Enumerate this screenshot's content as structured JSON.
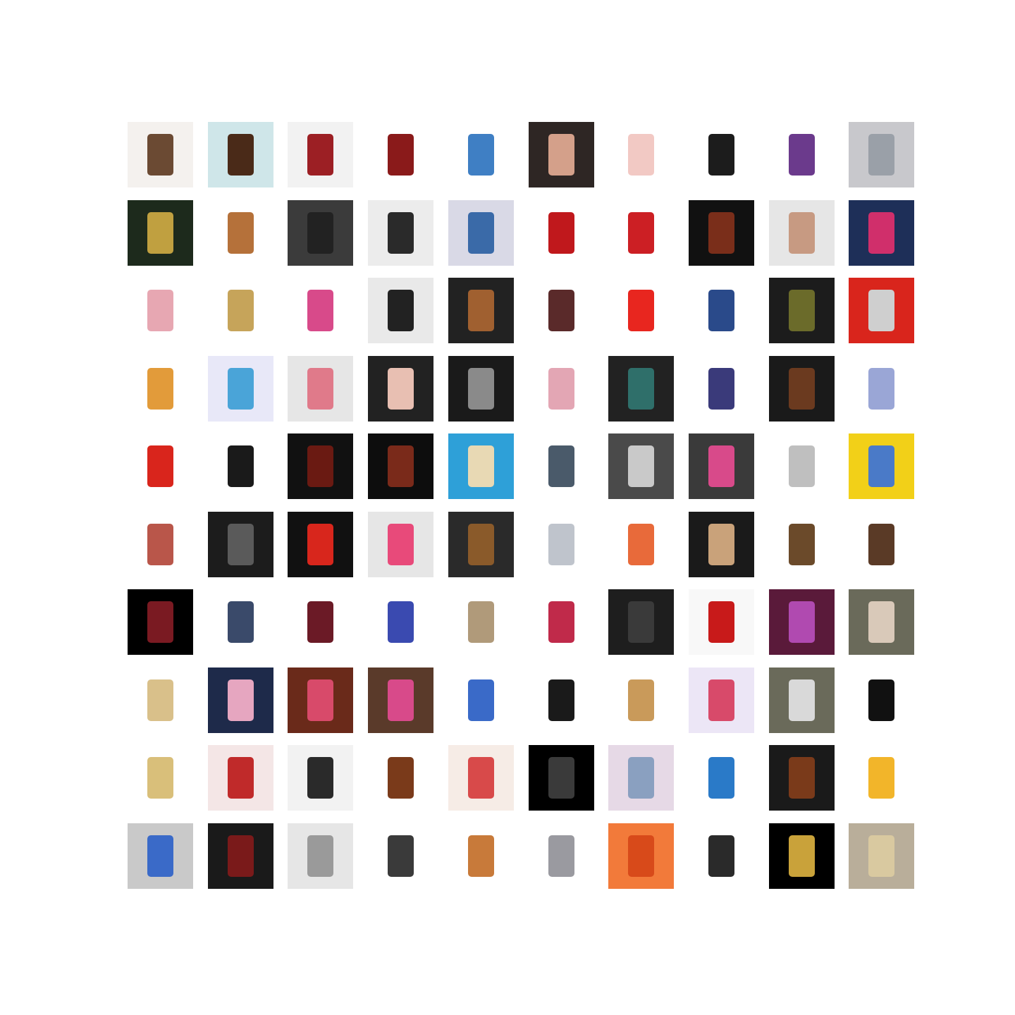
{
  "grid": {
    "rows": 10,
    "cols": 10,
    "tiles": [
      {
        "bg": "#f4f1ee",
        "accent": "#6b4a33",
        "caption": ""
      },
      {
        "bg": "#cfe6e9",
        "accent": "#4a2a18",
        "caption": ""
      },
      {
        "bg": "#f2f2f2",
        "accent": "#9c1f24",
        "caption": ""
      },
      {
        "bg": "#ffffff",
        "accent": "#8a1a1a",
        "caption": ""
      },
      {
        "bg": "#ffffff",
        "accent": "#3f7fc4",
        "caption": ""
      },
      {
        "bg": "#2e2624",
        "accent": "#d4a08a",
        "caption": ""
      },
      {
        "bg": "#ffffff",
        "accent": "#f2c9c4",
        "caption": ""
      },
      {
        "bg": "#ffffff",
        "accent": "#1c1c1c",
        "caption": ""
      },
      {
        "bg": "#ffffff",
        "accent": "#6b3a8c",
        "caption": ""
      },
      {
        "bg": "#c8c8cc",
        "accent": "#9aa0a8",
        "caption": ""
      },
      {
        "bg": "#1d2a1c",
        "accent": "#c0a040",
        "caption": ""
      },
      {
        "bg": "#ffffff",
        "accent": "#b5713a",
        "caption": ""
      },
      {
        "bg": "#3b3b3b",
        "accent": "#222222",
        "caption": ""
      },
      {
        "bg": "#ececec",
        "accent": "#2a2a2a",
        "caption": ""
      },
      {
        "bg": "#d9d9e6",
        "accent": "#3a6aa8",
        "caption": ""
      },
      {
        "bg": "#ffffff",
        "accent": "#c0181c",
        "caption": ""
      },
      {
        "bg": "#ffffff",
        "accent": "#cc1f24",
        "caption": ""
      },
      {
        "bg": "#111111",
        "accent": "#7a2e1a",
        "caption": ""
      },
      {
        "bg": "#e6e6e6",
        "accent": "#c79a82",
        "caption": ""
      },
      {
        "bg": "#1e2f58",
        "accent": "#d02f6b",
        "caption": ""
      },
      {
        "bg": "#ffffff",
        "accent": "#e7a7b2",
        "caption": ""
      },
      {
        "bg": "#ffffff",
        "accent": "#c6a45a",
        "caption": ""
      },
      {
        "bg": "#ffffff",
        "accent": "#d84a8a",
        "caption": ""
      },
      {
        "bg": "#e9e9e9",
        "accent": "#222222",
        "caption": ""
      },
      {
        "bg": "#222222",
        "accent": "#a06030",
        "caption": ""
      },
      {
        "bg": "#ffffff",
        "accent": "#5a2a2a",
        "caption": ""
      },
      {
        "bg": "#ffffff",
        "accent": "#e8261f",
        "caption": ""
      },
      {
        "bg": "#ffffff",
        "accent": "#2a4a8a",
        "caption": ""
      },
      {
        "bg": "#1c1c1c",
        "accent": "#6b6b2a",
        "caption": ""
      },
      {
        "bg": "#d9251c",
        "accent": "#cfcfcf",
        "caption": ""
      },
      {
        "bg": "#ffffff",
        "accent": "#e29b3a",
        "caption": ""
      },
      {
        "bg": "#e8e8f8",
        "accent": "#4aa4d8",
        "caption": ""
      },
      {
        "bg": "#e6e6e6",
        "accent": "#e07a8a",
        "caption": ""
      },
      {
        "bg": "#222222",
        "accent": "#e8bfb2",
        "caption": ""
      },
      {
        "bg": "#1a1a1a",
        "accent": "#8a8a8a",
        "caption": ""
      },
      {
        "bg": "#ffffff",
        "accent": "#e3a6b4",
        "caption": ""
      },
      {
        "bg": "#222222",
        "accent": "#2f6f6a",
        "caption": ""
      },
      {
        "bg": "#ffffff",
        "accent": "#3a3a7a",
        "caption": ""
      },
      {
        "bg": "#1a1a1a",
        "accent": "#6b3a1f",
        "caption": ""
      },
      {
        "bg": "#ffffff",
        "accent": "#9aa6d6",
        "caption": ""
      },
      {
        "bg": "#ffffff",
        "accent": "#d9251c",
        "caption": ""
      },
      {
        "bg": "#ffffff",
        "accent": "#1a1a1a",
        "caption": ""
      },
      {
        "bg": "#111111",
        "accent": "#6a1a12",
        "caption": ""
      },
      {
        "bg": "#0d0d0d",
        "accent": "#7a2a1a",
        "caption": ""
      },
      {
        "bg": "#2ea0d8",
        "accent": "#e8d9b4",
        "caption": ""
      },
      {
        "bg": "#ffffff",
        "accent": "#4a5a6a",
        "caption": ""
      },
      {
        "bg": "#4a4a4a",
        "accent": "#c9c9c9",
        "caption": ""
      },
      {
        "bg": "#3a3a3a",
        "accent": "#d84a8a",
        "caption": ""
      },
      {
        "bg": "#ffffff",
        "accent": "#bfbfbf",
        "caption": ""
      },
      {
        "bg": "#f2d018",
        "accent": "#4a7ac8",
        "caption": ""
      },
      {
        "bg": "#ffffff",
        "accent": "#b9564a",
        "caption": ""
      },
      {
        "bg": "#1c1c1c",
        "accent": "#5a5a5a",
        "caption": ""
      },
      {
        "bg": "#111111",
        "accent": "#d8261c",
        "caption": ""
      },
      {
        "bg": "#e6e6e6",
        "accent": "#e84a7a",
        "caption": ""
      },
      {
        "bg": "#2a2a2a",
        "accent": "#8a5a2a",
        "caption": ""
      },
      {
        "bg": "#ffffff",
        "accent": "#bfc4cc",
        "caption": ""
      },
      {
        "bg": "#ffffff",
        "accent": "#e86a3a",
        "caption": ""
      },
      {
        "bg": "#1a1a1a",
        "accent": "#c9a27a",
        "caption": ""
      },
      {
        "bg": "#ffffff",
        "accent": "#6b4a2a",
        "caption": ""
      },
      {
        "bg": "#ffffff",
        "accent": "#5a3a26",
        "caption": ""
      },
      {
        "bg": "#000000",
        "accent": "#7a1a22",
        "caption": ""
      },
      {
        "bg": "#ffffff",
        "accent": "#3a4a6a",
        "caption": ""
      },
      {
        "bg": "#ffffff",
        "accent": "#6b1a26",
        "caption": ""
      },
      {
        "bg": "#ffffff",
        "accent": "#3a4ab0",
        "caption": ""
      },
      {
        "bg": "#ffffff",
        "accent": "#b09a7a",
        "caption": ""
      },
      {
        "bg": "#ffffff",
        "accent": "#c02a4a",
        "caption": ""
      },
      {
        "bg": "#1e1e1e",
        "accent": "#3a3a3a",
        "caption": ""
      },
      {
        "bg": "#f8f8f8",
        "accent": "#c81a1a",
        "caption": ""
      },
      {
        "bg": "#5a1a3a",
        "accent": "#b04ab0",
        "caption": ""
      },
      {
        "bg": "#6a6a5a",
        "accent": "#d9c9b9",
        "caption": ""
      },
      {
        "bg": "#ffffff",
        "accent": "#d9c08a",
        "caption": ""
      },
      {
        "bg": "#1e2a4a",
        "accent": "#e6a6c0",
        "caption": ""
      },
      {
        "bg": "#6a2a1a",
        "accent": "#d84a6a",
        "caption": ""
      },
      {
        "bg": "#5a3a2a",
        "accent": "#d84a8a",
        "caption": ""
      },
      {
        "bg": "#ffffff",
        "accent": "#3a6ac8",
        "caption": ""
      },
      {
        "bg": "#ffffff",
        "accent": "#1a1a1a",
        "caption": ""
      },
      {
        "bg": "#ffffff",
        "accent": "#c99a5a",
        "caption": ""
      },
      {
        "bg": "#ece6f6",
        "accent": "#d84a6a",
        "caption": ""
      },
      {
        "bg": "#6a6a5a",
        "accent": "#d9d9d9",
        "caption": ""
      },
      {
        "bg": "#ffffff",
        "accent": "#111111",
        "caption": ""
      },
      {
        "bg": "#ffffff",
        "accent": "#d9bf7a",
        "caption": ""
      },
      {
        "bg": "#f4e6e6",
        "accent": "#c02a2a",
        "caption": ""
      },
      {
        "bg": "#f2f2f2",
        "accent": "#2a2a2a",
        "caption": ""
      },
      {
        "bg": "#ffffff",
        "accent": "#7a3a1a",
        "caption": ""
      },
      {
        "bg": "#f6ece6",
        "accent": "#d84a4a",
        "caption": ""
      },
      {
        "bg": "#000000",
        "accent": "#3a3a3a",
        "caption": ""
      },
      {
        "bg": "#e6d9e6",
        "accent": "#8aa0c0",
        "caption": ""
      },
      {
        "bg": "#ffffff",
        "accent": "#2a7ac8",
        "caption": ""
      },
      {
        "bg": "#1a1a1a",
        "accent": "#7a3a1a",
        "caption": ""
      },
      {
        "bg": "#ffffff",
        "accent": "#f2b52a",
        "caption": ""
      },
      {
        "bg": "#c9c9c9",
        "accent": "#3a6ac8",
        "caption": ""
      },
      {
        "bg": "#1a1a1a",
        "accent": "#7a1a1a",
        "caption": ""
      },
      {
        "bg": "#e6e6e6",
        "accent": "#9a9a9a",
        "caption": ""
      },
      {
        "bg": "#ffffff",
        "accent": "#3a3a3a",
        "caption": ""
      },
      {
        "bg": "#ffffff",
        "accent": "#c87a3a",
        "caption": ""
      },
      {
        "bg": "#ffffff",
        "accent": "#9a9aa0",
        "caption": ""
      },
      {
        "bg": "#f27a3a",
        "accent": "#d84a1a",
        "caption": ""
      },
      {
        "bg": "#ffffff",
        "accent": "#2a2a2a",
        "caption": ""
      },
      {
        "bg": "#000000",
        "accent": "#c9a23a",
        "caption": ""
      },
      {
        "bg": "#b9ae9a",
        "accent": "#d9c9a0",
        "caption": ""
      }
    ]
  }
}
